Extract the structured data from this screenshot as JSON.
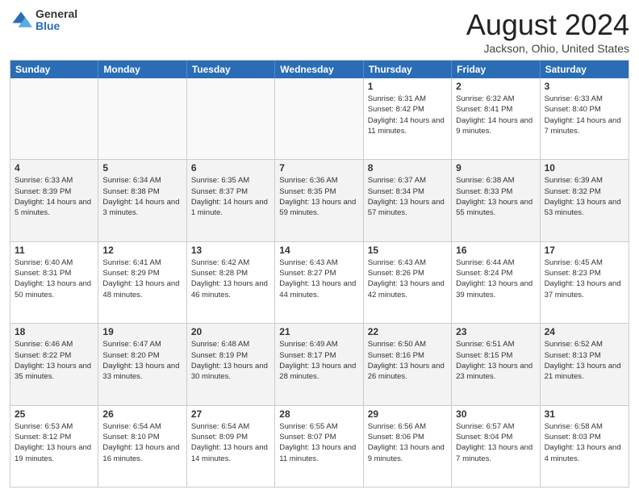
{
  "logo": {
    "general": "General",
    "blue": "Blue"
  },
  "title": "August 2024",
  "subtitle": "Jackson, Ohio, United States",
  "header_days": [
    "Sunday",
    "Monday",
    "Tuesday",
    "Wednesday",
    "Thursday",
    "Friday",
    "Saturday"
  ],
  "rows": [
    [
      {
        "day": "",
        "info": "",
        "empty": true
      },
      {
        "day": "",
        "info": "",
        "empty": true
      },
      {
        "day": "",
        "info": "",
        "empty": true
      },
      {
        "day": "",
        "info": "",
        "empty": true
      },
      {
        "day": "1",
        "info": "Sunrise: 6:31 AM\nSunset: 8:42 PM\nDaylight: 14 hours\nand 11 minutes.",
        "empty": false
      },
      {
        "day": "2",
        "info": "Sunrise: 6:32 AM\nSunset: 8:41 PM\nDaylight: 14 hours\nand 9 minutes.",
        "empty": false
      },
      {
        "day": "3",
        "info": "Sunrise: 6:33 AM\nSunset: 8:40 PM\nDaylight: 14 hours\nand 7 minutes.",
        "empty": false
      }
    ],
    [
      {
        "day": "4",
        "info": "Sunrise: 6:33 AM\nSunset: 8:39 PM\nDaylight: 14 hours\nand 5 minutes.",
        "empty": false
      },
      {
        "day": "5",
        "info": "Sunrise: 6:34 AM\nSunset: 8:38 PM\nDaylight: 14 hours\nand 3 minutes.",
        "empty": false
      },
      {
        "day": "6",
        "info": "Sunrise: 6:35 AM\nSunset: 8:37 PM\nDaylight: 14 hours\nand 1 minute.",
        "empty": false
      },
      {
        "day": "7",
        "info": "Sunrise: 6:36 AM\nSunset: 8:35 PM\nDaylight: 13 hours\nand 59 minutes.",
        "empty": false
      },
      {
        "day": "8",
        "info": "Sunrise: 6:37 AM\nSunset: 8:34 PM\nDaylight: 13 hours\nand 57 minutes.",
        "empty": false
      },
      {
        "day": "9",
        "info": "Sunrise: 6:38 AM\nSunset: 8:33 PM\nDaylight: 13 hours\nand 55 minutes.",
        "empty": false
      },
      {
        "day": "10",
        "info": "Sunrise: 6:39 AM\nSunset: 8:32 PM\nDaylight: 13 hours\nand 53 minutes.",
        "empty": false
      }
    ],
    [
      {
        "day": "11",
        "info": "Sunrise: 6:40 AM\nSunset: 8:31 PM\nDaylight: 13 hours\nand 50 minutes.",
        "empty": false
      },
      {
        "day": "12",
        "info": "Sunrise: 6:41 AM\nSunset: 8:29 PM\nDaylight: 13 hours\nand 48 minutes.",
        "empty": false
      },
      {
        "day": "13",
        "info": "Sunrise: 6:42 AM\nSunset: 8:28 PM\nDaylight: 13 hours\nand 46 minutes.",
        "empty": false
      },
      {
        "day": "14",
        "info": "Sunrise: 6:43 AM\nSunset: 8:27 PM\nDaylight: 13 hours\nand 44 minutes.",
        "empty": false
      },
      {
        "day": "15",
        "info": "Sunrise: 6:43 AM\nSunset: 8:26 PM\nDaylight: 13 hours\nand 42 minutes.",
        "empty": false
      },
      {
        "day": "16",
        "info": "Sunrise: 6:44 AM\nSunset: 8:24 PM\nDaylight: 13 hours\nand 39 minutes.",
        "empty": false
      },
      {
        "day": "17",
        "info": "Sunrise: 6:45 AM\nSunset: 8:23 PM\nDaylight: 13 hours\nand 37 minutes.",
        "empty": false
      }
    ],
    [
      {
        "day": "18",
        "info": "Sunrise: 6:46 AM\nSunset: 8:22 PM\nDaylight: 13 hours\nand 35 minutes.",
        "empty": false
      },
      {
        "day": "19",
        "info": "Sunrise: 6:47 AM\nSunset: 8:20 PM\nDaylight: 13 hours\nand 33 minutes.",
        "empty": false
      },
      {
        "day": "20",
        "info": "Sunrise: 6:48 AM\nSunset: 8:19 PM\nDaylight: 13 hours\nand 30 minutes.",
        "empty": false
      },
      {
        "day": "21",
        "info": "Sunrise: 6:49 AM\nSunset: 8:17 PM\nDaylight: 13 hours\nand 28 minutes.",
        "empty": false
      },
      {
        "day": "22",
        "info": "Sunrise: 6:50 AM\nSunset: 8:16 PM\nDaylight: 13 hours\nand 26 minutes.",
        "empty": false
      },
      {
        "day": "23",
        "info": "Sunrise: 6:51 AM\nSunset: 8:15 PM\nDaylight: 13 hours\nand 23 minutes.",
        "empty": false
      },
      {
        "day": "24",
        "info": "Sunrise: 6:52 AM\nSunset: 8:13 PM\nDaylight: 13 hours\nand 21 minutes.",
        "empty": false
      }
    ],
    [
      {
        "day": "25",
        "info": "Sunrise: 6:53 AM\nSunset: 8:12 PM\nDaylight: 13 hours\nand 19 minutes.",
        "empty": false
      },
      {
        "day": "26",
        "info": "Sunrise: 6:54 AM\nSunset: 8:10 PM\nDaylight: 13 hours\nand 16 minutes.",
        "empty": false
      },
      {
        "day": "27",
        "info": "Sunrise: 6:54 AM\nSunset: 8:09 PM\nDaylight: 13 hours\nand 14 minutes.",
        "empty": false
      },
      {
        "day": "28",
        "info": "Sunrise: 6:55 AM\nSunset: 8:07 PM\nDaylight: 13 hours\nand 11 minutes.",
        "empty": false
      },
      {
        "day": "29",
        "info": "Sunrise: 6:56 AM\nSunset: 8:06 PM\nDaylight: 13 hours\nand 9 minutes.",
        "empty": false
      },
      {
        "day": "30",
        "info": "Sunrise: 6:57 AM\nSunset: 8:04 PM\nDaylight: 13 hours\nand 7 minutes.",
        "empty": false
      },
      {
        "day": "31",
        "info": "Sunrise: 6:58 AM\nSunset: 8:03 PM\nDaylight: 13 hours\nand 4 minutes.",
        "empty": false
      }
    ]
  ]
}
